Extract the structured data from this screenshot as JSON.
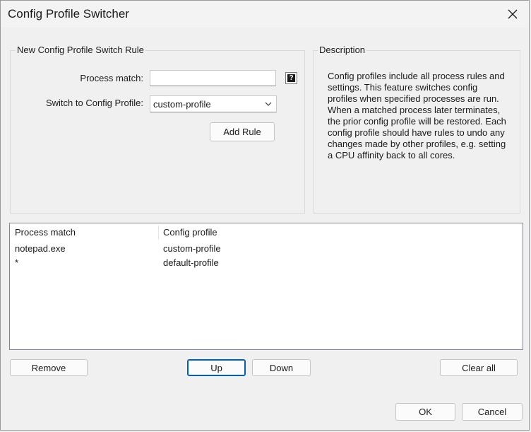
{
  "window": {
    "title": "Config Profile Switcher"
  },
  "rule_group": {
    "legend": "New Config Profile Switch Rule",
    "process_match_label": "Process match:",
    "process_match_value": "",
    "switch_to_label": "Switch to Config Profile:",
    "switch_to_value": "custom-profile",
    "add_rule_label": "Add Rule",
    "help_icon_glyph": "?"
  },
  "description_group": {
    "legend": "Description",
    "text": "Config profiles include all process rules and settings. This feature switches config profiles when specified processes are run. When a matched process later terminates, the prior config profile will be restored. Each config profile should have rules to undo any changes made by other profiles, e.g. setting a CPU affinity back to all cores."
  },
  "rules_table": {
    "columns": [
      "Process match",
      "Config profile"
    ],
    "rows": [
      {
        "process": "notepad.exe",
        "profile": "custom-profile"
      },
      {
        "process": "*",
        "profile": "default-profile"
      }
    ]
  },
  "buttons": {
    "remove": "Remove",
    "up": "Up",
    "down": "Down",
    "clear_all": "Clear all",
    "ok": "OK",
    "cancel": "Cancel"
  },
  "icons": {
    "close": "close-icon",
    "help": "help-icon",
    "dropdown": "chevron-down-icon"
  },
  "colors": {
    "background": "#f0f0f0",
    "focus_accent": "#005fb8"
  }
}
